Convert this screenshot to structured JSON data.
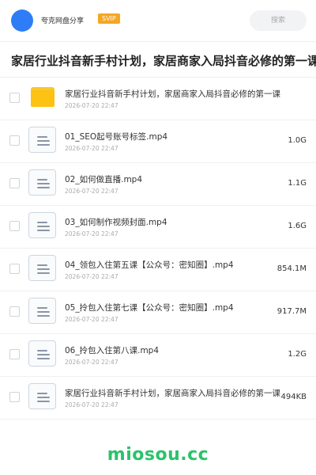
{
  "header": {
    "share_name": "夸克网盘分享",
    "badge": "SVIP",
    "search_placeholder": "搜索",
    "accent_color": "#2f7df6"
  },
  "folder_title": "家居行业抖音新手村计划，家居商家入局抖音必修的第一课",
  "files": [
    {
      "type": "folder",
      "name": "家居行业抖音新手村计划，家居商家入局抖音必修的第一课",
      "date": "2026-07-20 22:47",
      "size": ""
    },
    {
      "type": "file",
      "name": "01_SEO起号账号标签.mp4",
      "date": "2026-07-20 22:47",
      "size": "1.0G"
    },
    {
      "type": "file",
      "name": "02_如何做直播.mp4",
      "date": "2026-07-20 22:47",
      "size": "1.1G"
    },
    {
      "type": "file",
      "name": "03_如何制作视频封面.mp4",
      "date": "2026-07-20 22:47",
      "size": "1.6G"
    },
    {
      "type": "file",
      "name": "04_领包入住第五课【公众号：密知圈】.mp4",
      "date": "2026-07-20 22:47",
      "size": "854.1M"
    },
    {
      "type": "file",
      "name": "05_拎包入住第七课【公众号：密知圈】.mp4",
      "date": "2026-07-20 22:47",
      "size": "917.7M"
    },
    {
      "type": "file",
      "name": "06_拎包入住第八课.mp4",
      "date": "2026-07-20 22:47",
      "size": "1.2G"
    },
    {
      "type": "file",
      "name": "家居行业抖音新手村计划，家居商家入局抖音必修的第一课",
      "date": "2026-07-20 22:47",
      "size": "494KB"
    }
  ],
  "watermark": "miosou.cc"
}
